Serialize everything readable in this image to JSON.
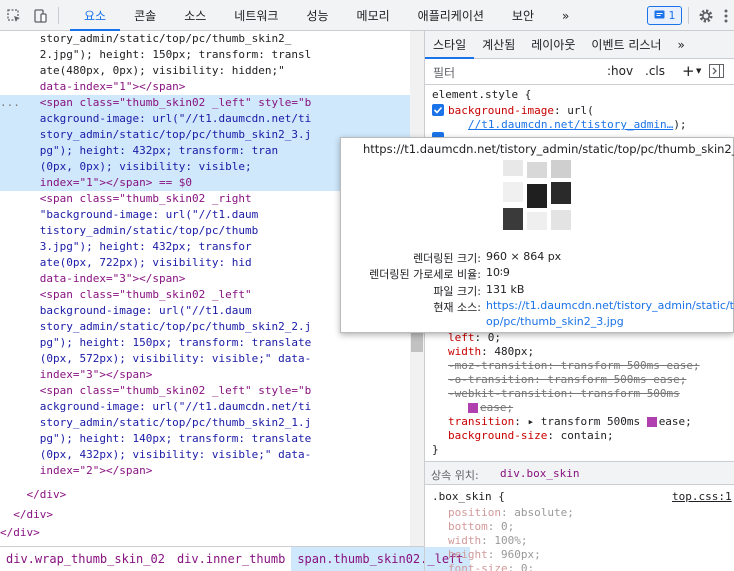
{
  "tabs": {
    "elements": "요소",
    "console": "콘솔",
    "sources": "소스",
    "network": "네트워크",
    "performance": "성능",
    "memory": "메모리",
    "application": "애플리케이션",
    "security": "보안",
    "more": "»"
  },
  "issues_count": "1",
  "dom_lines": [
    "      story_admin/static/top/pc/thumb_skin2_",
    "      2.jpg\"); height: 150px; transform: transl",
    "      ate(480px, 0px); visibility: hidden;\"",
    "      data-index=\"1\"></span>",
    "      <span class=\"thumb_skin02 _left\" style=\"b",
    "      ackground-image: url(\"//t1.daumcdn.net/ti",
    "      story_admin/static/top/pc/thumb_skin2_3.j",
    "      pg\"); height: 432px; transform: tran",
    "      (0px, 0px); visibility: visible;",
    "      index=\"1\"></span> == $0",
    "      <span class=\"thumb_skin02 _right",
    "      \"background-image: url(\"//t1.daum",
    "      tistory_admin/static/top/pc/thumb",
    "      3.jpg\"); height: 432px; transfor",
    "      ate(0px, 722px); visibility: hid",
    "      data-index=\"3\"></span>",
    "      <span class=\"thumb_skin02 _left\"",
    "      background-image: url(\"//t1.daum",
    "      story_admin/static/top/pc/thumb_skin2_2.j",
    "      pg\"); height: 150px; transform: translate",
    "      (0px, 572px); visibility: visible;\" data-",
    "      index=\"3\"></span>",
    "      <span class=\"thumb_skin02 _left\" style=\"b",
    "      ackground-image: url(\"//t1.daumcdn.net/ti",
    "      story_admin/static/top/pc/thumb_skin2_1.j",
    "      pg\"); height: 140px; transform: translate",
    "      (0px, 432px); visibility: visible;\" data-",
    "      index=\"2\"></span>",
    "    </div>",
    "  </div>",
    "</div>"
  ],
  "ellipsis": "...",
  "breadcrumb": [
    "div.wrap_thumb_skin_02",
    "div.inner_thumb",
    "span.thumb_skin02._left"
  ],
  "style_tabs": {
    "styles": "스타일",
    "computed": "계산됨",
    "layout": "레이아웃",
    "event_listeners": "이벤트 리스너",
    "more": "»"
  },
  "filter": {
    "placeholder": "필터",
    "hov": ":hov",
    "cls": ".cls"
  },
  "element_style": {
    "selector": "element.style {",
    "bg_prop": "background-image",
    "bg_val": ": url(",
    "bg_url": "//t1.daumcdn.net/tistory_admin…",
    "bg_close": ");"
  },
  "tooltip": {
    "url": "https://t1.daumcdn.net/tistory_admin/static/top/pc/thumb_skin2_3.jpg",
    "rendered_size_label": "렌더링된 크기:",
    "rendered_size": "960 × 864 px",
    "aspect_label": "렌더링된 가로세로 비율:",
    "aspect": "10∶9",
    "file_size_label": "파일 크기:",
    "file_size": "131 kB",
    "source_label": "현재 소스:",
    "source_1": "https://t1.daumcdn.net/tistory_admin/static/t",
    "source_2": "op/pc/thumb_skin2_3.jpg"
  },
  "rules": {
    "left": "left",
    "left_val": ": 0;",
    "width": "width",
    "width_val": ": 480px;",
    "moz": "-moz-transition",
    "moz_val": ": transform 500ms ease;",
    "o": "-o-transition",
    "o_val": ": transform 500ms ease;",
    "webkit": "-webkit-transition",
    "webkit_val": ": transform 500ms",
    "webkit_val2": "ease;",
    "transition": "transition",
    "transition_val1": ": ▸ transform 500ms ",
    "transition_val2": "ease;",
    "bgsize": "background-size",
    "bgsize_val": ": contain;",
    "close": "}"
  },
  "inherited": {
    "label": "상속 위치:",
    "from": "div.box_skin"
  },
  "box_skin": {
    "selector": ".box_skin {",
    "source": "top.css:1",
    "position": "position",
    "position_val": ": absolute;",
    "bottom": "bottom",
    "bottom_val": ": 0;",
    "width": "width",
    "width_val": ": 100%;",
    "height": "height",
    "height_val": ": 960px;",
    "fontsize": "font-size",
    "fontsize_val": ": 0;"
  },
  "colors": {
    "accent": "#1a73e8",
    "tag": "#881280",
    "attr": "#994500",
    "value": "#1a1aa6",
    "prop": "#c80000",
    "selected": "#cfe8fc"
  }
}
